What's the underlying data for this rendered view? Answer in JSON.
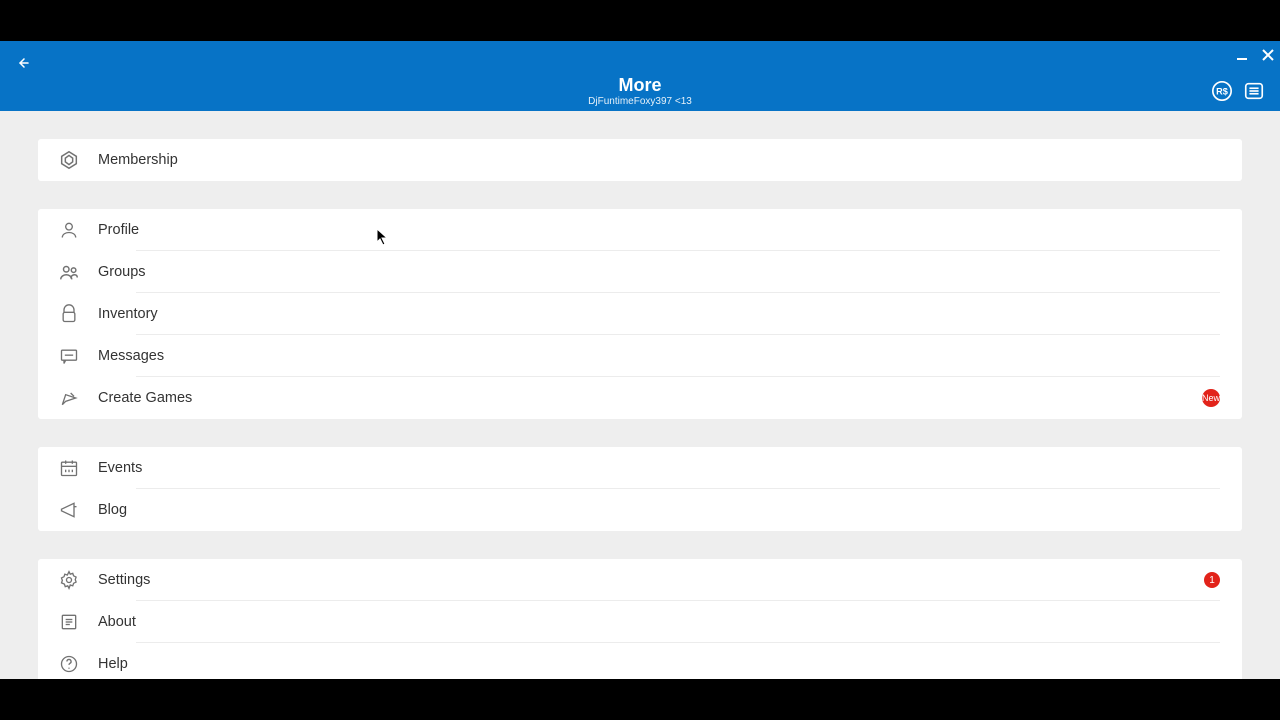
{
  "header": {
    "title": "More",
    "subtitle": "DjFuntimeFoxy397 <13"
  },
  "sections": [
    {
      "items": [
        {
          "label": "Membership",
          "icon": "membership"
        }
      ]
    },
    {
      "items": [
        {
          "label": "Profile",
          "icon": "profile"
        },
        {
          "label": "Groups",
          "icon": "groups"
        },
        {
          "label": "Inventory",
          "icon": "inventory"
        },
        {
          "label": "Messages",
          "icon": "messages"
        },
        {
          "label": "Create Games",
          "icon": "create",
          "badge": "New"
        }
      ]
    },
    {
      "items": [
        {
          "label": "Events",
          "icon": "events"
        },
        {
          "label": "Blog",
          "icon": "blog"
        }
      ]
    },
    {
      "items": [
        {
          "label": "Settings",
          "icon": "settings",
          "badge": "1"
        },
        {
          "label": "About",
          "icon": "about"
        },
        {
          "label": "Help",
          "icon": "help"
        }
      ]
    }
  ]
}
